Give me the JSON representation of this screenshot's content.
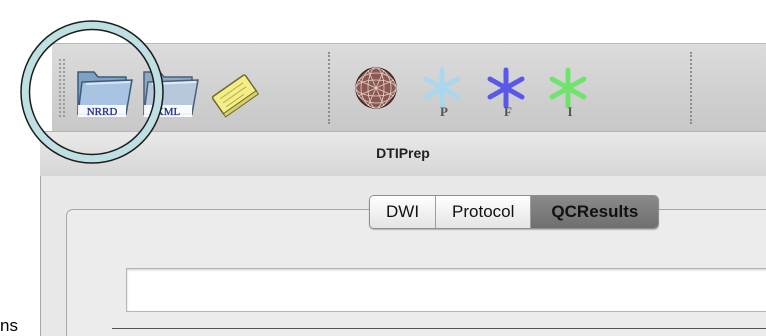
{
  "window": {
    "title": "DTIPrep"
  },
  "toolbar": {
    "buttons": [
      {
        "name": "open-nrrd-button",
        "label": "NRRD",
        "icon": "folder-icon"
      },
      {
        "name": "open-xml-button",
        "label": "XML",
        "icon": "folder-icon"
      },
      {
        "name": "notes-button",
        "icon": "notepad-icon"
      },
      {
        "name": "mesh-sphere-button",
        "icon": "sphere-mesh-icon"
      },
      {
        "name": "p-button",
        "label": "P",
        "icon": "asterisk-icon",
        "color": "#a9d8ee"
      },
      {
        "name": "f-button",
        "label": "F",
        "icon": "asterisk-icon",
        "color": "#5b58e8"
      },
      {
        "name": "i-button",
        "label": "I",
        "icon": "asterisk-icon",
        "color": "#6fe36c"
      }
    ]
  },
  "tabs": [
    {
      "label": "DWI",
      "selected": false
    },
    {
      "label": "Protocol",
      "selected": false
    },
    {
      "label": "QCResults",
      "selected": true
    }
  ],
  "side_label": "ns",
  "colors": {
    "highlight_ring": "#1b1b1b",
    "ring_fill": "#bfe0e3"
  }
}
